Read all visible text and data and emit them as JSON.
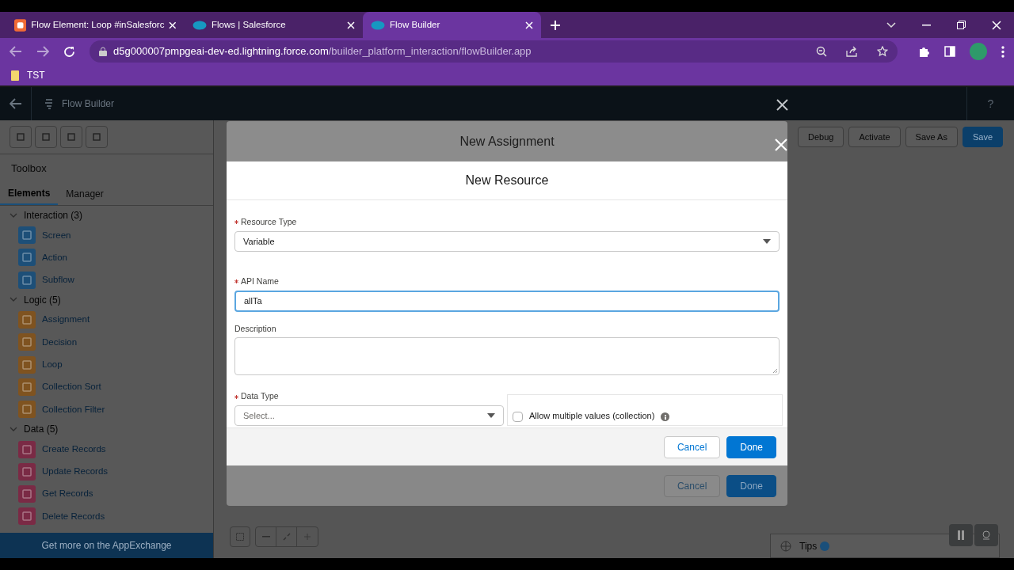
{
  "browser": {
    "tabs": [
      {
        "title": "Flow Element: Loop #inSalesforc",
        "kind": "blog",
        "selected": false
      },
      {
        "title": "Flows | Salesforce",
        "kind": "cloud",
        "selected": false
      },
      {
        "title": "Flow Builder",
        "kind": "cloud",
        "selected": true
      }
    ],
    "url_host": "d5g000007pmpgeai-dev-ed.lightning.force.com",
    "url_path": "/builder_platform_interaction/flowBuilder.app",
    "bookmarks": [
      {
        "label": "TST"
      }
    ]
  },
  "app": {
    "title": "Flow Builder",
    "help": "?",
    "actions": [
      {
        "label": "Debug",
        "kind": "neutral"
      },
      {
        "label": "Activate",
        "kind": "neutral"
      },
      {
        "label": "Save As",
        "kind": "neutral"
      },
      {
        "label": "Save",
        "kind": "brand"
      }
    ]
  },
  "toolbox": {
    "title": "Toolbox",
    "tabs": [
      {
        "label": "Elements",
        "selected": true
      },
      {
        "label": "Manager",
        "selected": false
      }
    ],
    "groups": [
      {
        "label": "Interaction (3)",
        "expanded": true,
        "color": "#1d4f78",
        "children": [
          {
            "label": "Screen"
          },
          {
            "label": "Action"
          },
          {
            "label": "Subflow"
          }
        ]
      },
      {
        "label": "Logic (5)",
        "expanded": true,
        "color": "#7f5320",
        "children": [
          {
            "label": "Assignment"
          },
          {
            "label": "Decision"
          },
          {
            "label": "Loop"
          },
          {
            "label": "Collection Sort"
          },
          {
            "label": "Collection Filter"
          }
        ]
      },
      {
        "label": "Data (5)",
        "expanded": true,
        "color": "#7a2a45",
        "children": [
          {
            "label": "Create Records"
          },
          {
            "label": "Update Records"
          },
          {
            "label": "Get Records"
          },
          {
            "label": "Delete Records"
          }
        ]
      }
    ],
    "footer": "Get more on the AppExchange"
  },
  "outer_modal": {
    "title": "New Assignment",
    "buttons": [
      {
        "label": "Cancel",
        "kind": "neutral"
      },
      {
        "label": "Done",
        "kind": "brand"
      }
    ]
  },
  "modal": {
    "title": "New Resource",
    "resource_type": {
      "label": "Resource Type",
      "required": true,
      "value": "Variable"
    },
    "api_name": {
      "label": "API Name",
      "required": true,
      "value": "allTa",
      "focused": true
    },
    "description": {
      "label": "Description"
    },
    "data_type": {
      "label": "Data Type",
      "required": true,
      "placeholder": "Select..."
    },
    "collection": {
      "label": "Allow multiple values (collection)",
      "checked": false
    },
    "buttons": [
      {
        "label": "Cancel",
        "kind": "neutral"
      },
      {
        "label": "Done",
        "kind": "brand"
      }
    ]
  },
  "tips": {
    "label": "Tips"
  }
}
